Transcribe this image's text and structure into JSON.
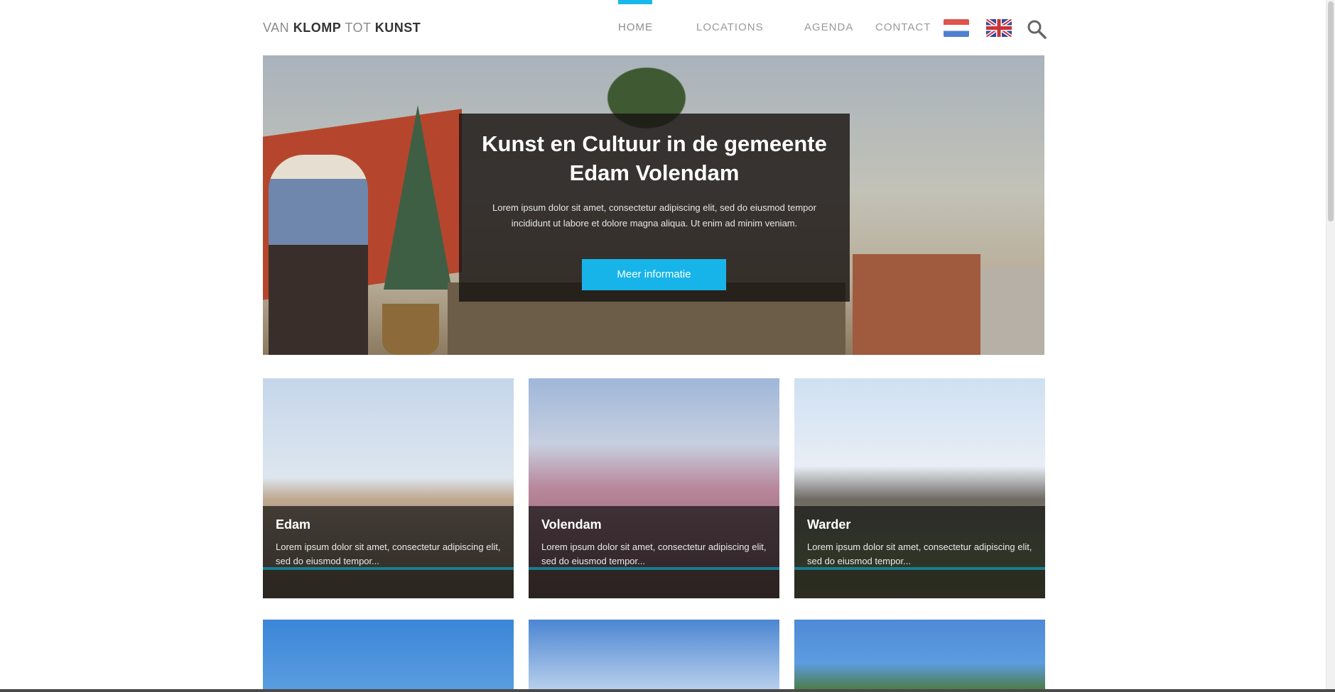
{
  "header": {
    "logo_parts": [
      "VAN",
      "KLOMP",
      "TOT",
      "KUNST"
    ]
  },
  "nav": {
    "items": [
      {
        "label": "HOME",
        "active": true
      },
      {
        "label": "LOCATIONS"
      },
      {
        "label": "AGENDA"
      },
      {
        "label": "CONTACT"
      }
    ],
    "languages": [
      "flag-nl-icon",
      "flag-uk-icon"
    ],
    "search_icon": "search-icon",
    "accent_color": "#19b8ea"
  },
  "hero": {
    "title": "Kunst en Cultuur in de gemeente Edam Volendam",
    "text": "Lorem ipsum dolor sit amet, consectetur adipiscing elit, sed do eiusmod tempor incididunt ut labore et dolore magna aliqua. Ut enim ad minim veniam.",
    "button": "Meer informatie",
    "button_color": "#17b4e9"
  },
  "cards": [
    {
      "title": "Edam",
      "text": "Lorem ipsum dolor sit amet, consectetur adipiscing elit, sed do eiusmod tempor..."
    },
    {
      "title": "Volendam",
      "text": "Lorem ipsum dolor sit amet, consectetur adipiscing elit, sed do eiusmod tempor..."
    },
    {
      "title": "Warder",
      "text": "Lorem ipsum dolor sit amet, consectetur adipiscing elit, sed do eiusmod tempor..."
    }
  ]
}
